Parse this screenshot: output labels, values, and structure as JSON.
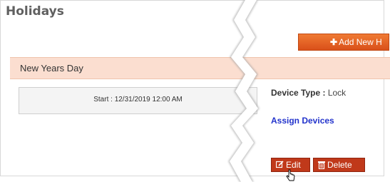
{
  "title": "Holidays",
  "add_button": {
    "icon": "plus-icon",
    "label": "Add New H"
  },
  "holiday": {
    "name": "New Years Day",
    "start_label": "Start : 12/31/2019 12:00 AM",
    "device_type_label": "Device Type :",
    "device_type_value": "Lock",
    "assign_label": "Assign Devices"
  },
  "actions": {
    "edit_label": "Edit",
    "edit_icon": "edit-icon",
    "delete_label": "Delete",
    "delete_icon": "trash-icon"
  },
  "colors": {
    "accent": "#e8642a",
    "header_bg": "#fbded0",
    "action": "#c0391a",
    "link": "#2233cc"
  }
}
